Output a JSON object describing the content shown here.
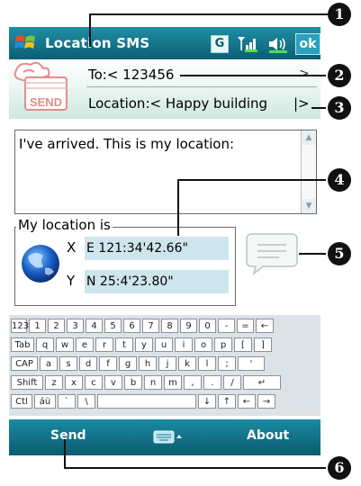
{
  "titlebar": {
    "title": "Location SMS",
    "network_indicator": "G",
    "ok_label": "ok",
    "start_icon": "windows-flag-icon",
    "signal_icon": "signal-strength-icon",
    "volume_icon": "speaker-icon"
  },
  "header": {
    "to_label": "To:< 123456",
    "to_next": ">",
    "location_label": "Location:< Happy building",
    "location_next": "|>",
    "send_icon_label": "SEND"
  },
  "message": {
    "text": "I've arrived. This is my location:"
  },
  "location": {
    "group_title": "My location is",
    "x_label": "X",
    "x_value": "E 121:34'42.66\"",
    "y_label": "Y",
    "y_value": "N 25:4'23.80\""
  },
  "keyboard": {
    "rows": [
      [
        "123",
        "1",
        "2",
        "3",
        "4",
        "5",
        "6",
        "7",
        "8",
        "9",
        "0",
        "-",
        "=",
        "←"
      ],
      [
        "Tab",
        "q",
        "w",
        "e",
        "r",
        "t",
        "y",
        "u",
        "i",
        "o",
        "p",
        "[",
        "]"
      ],
      [
        "CAP",
        "a",
        "s",
        "d",
        "f",
        "g",
        "h",
        "j",
        "k",
        "l",
        ";",
        "'"
      ],
      [
        "Shift",
        "z",
        "x",
        "c",
        "v",
        "b",
        "n",
        "m",
        ",",
        ".",
        "/",
        "↵"
      ],
      [
        "Ctl",
        "áü",
        "`",
        "\\",
        "",
        "↓",
        "↑",
        "←",
        "→"
      ]
    ]
  },
  "menubar": {
    "left_label": "Send",
    "right_label": "About"
  },
  "callouts": [
    "1",
    "2",
    "3",
    "4",
    "5",
    "6"
  ],
  "colors": {
    "titlebar": "#0c5e73",
    "menubar": "#0b5b70",
    "coord_field": "#cfe5ee"
  }
}
